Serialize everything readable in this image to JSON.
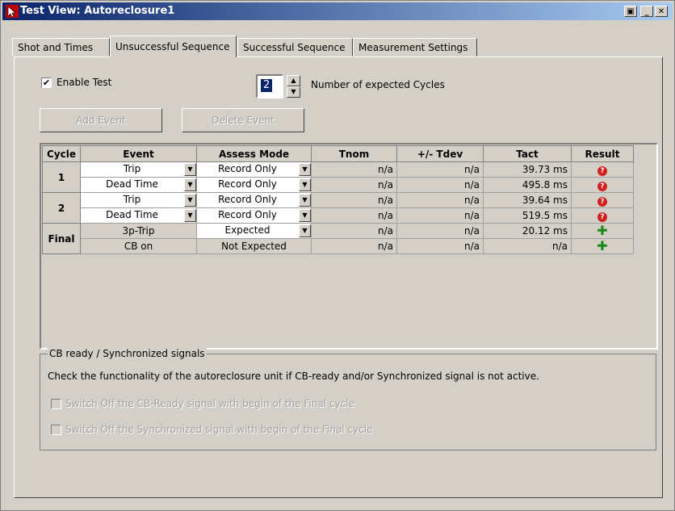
{
  "window": {
    "title": "Test View: Autoreclosure1",
    "buttons": {
      "restore": "▣",
      "minimize": "_",
      "maximize": "□",
      "close": "✕"
    }
  },
  "tabs": [
    {
      "label": "Shot and Times",
      "active": false
    },
    {
      "label": "Unsuccessful Sequence",
      "active": true
    },
    {
      "label": "Successful Sequence",
      "active": false
    },
    {
      "label": "Measurement Settings",
      "active": false
    }
  ],
  "enable_test": {
    "label": "Enable Test",
    "checked": true,
    "mark": "✔"
  },
  "cycles_spinner": {
    "value": "2",
    "label": "Number of expected Cycles",
    "up": "▲",
    "down": "▼"
  },
  "buttons": {
    "add_event": "Add Event",
    "delete_event": "Delete Event"
  },
  "table": {
    "headers": [
      "Cycle",
      "Event",
      "Assess Mode",
      "Tnom",
      "+/- Tdev",
      "Tact",
      "Result"
    ],
    "cycles": [
      "1",
      "2",
      "Final"
    ],
    "rows": [
      {
        "event": "Trip",
        "assess": "Record Only",
        "tnom": "n/a",
        "tdev": "n/a",
        "tact": "39.73 ms",
        "result": "fail"
      },
      {
        "event": "Dead Time",
        "assess": "Record Only",
        "tnom": "n/a",
        "tdev": "n/a",
        "tact": "495.8 ms",
        "result": "fail"
      },
      {
        "event": "Trip",
        "assess": "Record Only",
        "tnom": "n/a",
        "tdev": "n/a",
        "tact": "39.64 ms",
        "result": "fail"
      },
      {
        "event": "Dead Time",
        "assess": "Record Only",
        "tnom": "n/a",
        "tdev": "n/a",
        "tact": "519.5 ms",
        "result": "fail"
      },
      {
        "event": "3p-Trip",
        "assess": "Expected",
        "tnom": "n/a",
        "tdev": "n/a",
        "tact": "20.12 ms",
        "result": "pass"
      },
      {
        "event": "CB on",
        "assess": "Not Expected",
        "tnom": "n/a",
        "tdev": "n/a",
        "tact": "n/a",
        "result": "pass"
      }
    ],
    "combo_arrow": "▼",
    "fail_glyph": "?",
    "pass_glyph": "✚"
  },
  "cb_group": {
    "title": "CB ready / Synchronized signals",
    "description": "Check the functionality of the autoreclosure unit if CB-ready and/or Synchronized signal is not active.",
    "option1": "Switch Off the CB-Ready signal with begin of the Final cycle",
    "option2": "Switch Off the Synchronized signal with begin of the Final cycle"
  },
  "colors": {
    "title_bar": "#0a246a",
    "fail": "#d02020",
    "pass": "#1a8a1a"
  }
}
